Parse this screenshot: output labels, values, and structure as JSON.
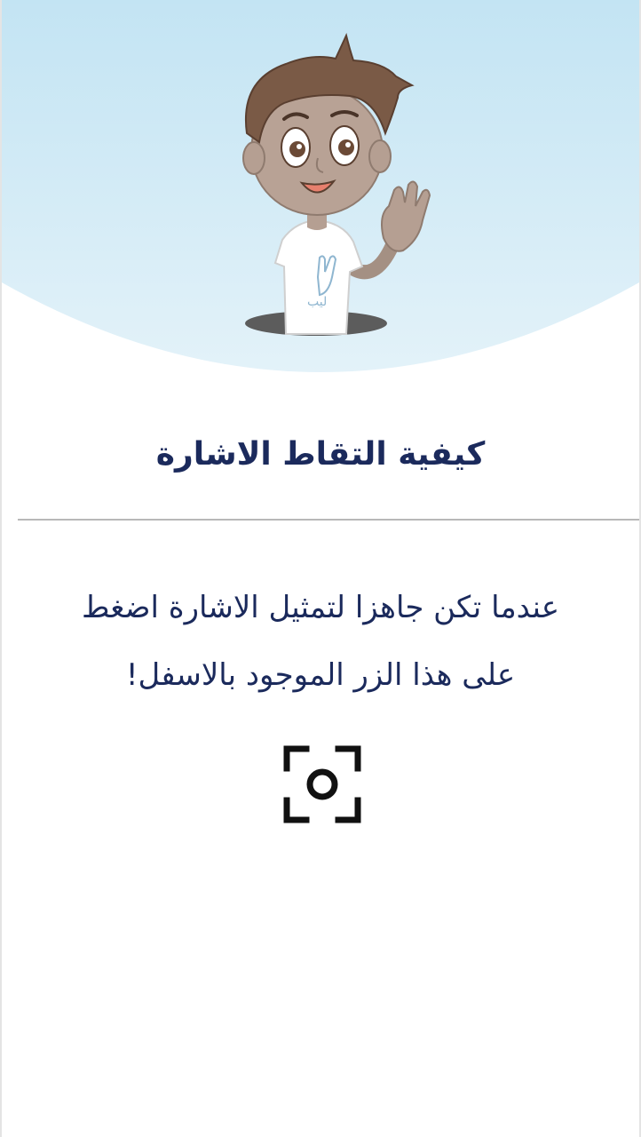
{
  "hero": {
    "illustration": "waving-boy-mascot",
    "shirt_logo_text": "ليب",
    "background_color": "#c9e7f4",
    "curve_color": "#ffffff"
  },
  "title": "كيفية التقاط الاشارة",
  "instruction": {
    "line1": "عندما تكن جاهزا لتمثيل الاشارة اضغط",
    "line2": "على هذا الزر الموجود بالاسفل!"
  },
  "capture_button": {
    "icon": "camera-capture-icon",
    "color": "#111111"
  },
  "colors": {
    "text_primary": "#1b2a5c",
    "divider": "#b8b8b8"
  }
}
